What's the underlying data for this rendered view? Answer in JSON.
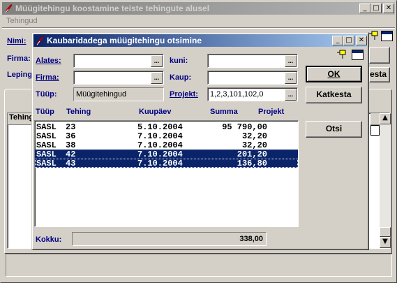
{
  "main_window": {
    "title": "Müügitehingu koostamine teiste tehingute alusel",
    "menu_item": "Tehingud",
    "label_nimi": "Nimi:",
    "label_firma": "Firma:",
    "label_leping": "Leping",
    "col_tehing": "Tehing",
    "partial_button": "esta"
  },
  "dialog": {
    "title": "Kaubaridadega müügitehingu otsimine",
    "labels": {
      "alates": "Alates:",
      "kuni": "kuni:",
      "firma": "Firma:",
      "kaup": "Kaup:",
      "tuup": "Tüüp:",
      "projekt": "Projekt:"
    },
    "fields": {
      "alates": "",
      "kuni": "",
      "firma": "",
      "kaup": "",
      "tuup": "Müügitehingud",
      "projekt": "1,2,3,101,102,0"
    },
    "buttons": {
      "ok": "OK",
      "katkesta": "Katkesta",
      "otsi": "Otsi"
    },
    "columns": [
      "Tüüp",
      "Tehing",
      "Kuupäev",
      "Summa",
      "Projekt"
    ],
    "rows": [
      {
        "tuup": "SASL",
        "tehing": "23",
        "kuupaev": "5.10.2004",
        "summa": "95 790,00",
        "selected": false
      },
      {
        "tuup": "SASL",
        "tehing": "36",
        "kuupaev": "7.10.2004",
        "summa": "32,20",
        "selected": false
      },
      {
        "tuup": "SASL",
        "tehing": "38",
        "kuupaev": "7.10.2004",
        "summa": "32,20",
        "selected": false
      },
      {
        "tuup": "SASL",
        "tehing": "42",
        "kuupaev": "7.10.2004",
        "summa": "201,20",
        "selected": true
      },
      {
        "tuup": "SASL",
        "tehing": "43",
        "kuupaev": "7.10.2004",
        "summa": "136,80",
        "selected": true
      }
    ],
    "kokku_label": "Kokku:",
    "kokku_value": "338,00"
  },
  "colors": {
    "inactive_title": "#808080",
    "active_title": "#0a246a",
    "label_blue": "#000080"
  }
}
